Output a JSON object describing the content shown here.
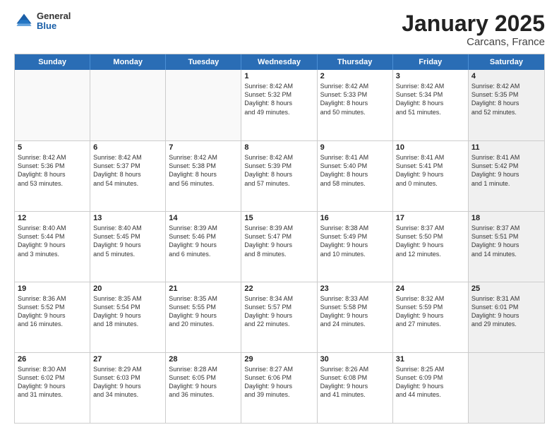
{
  "logo": {
    "general": "General",
    "blue": "Blue"
  },
  "header": {
    "title": "January 2025",
    "location": "Carcans, France"
  },
  "weekdays": [
    "Sunday",
    "Monday",
    "Tuesday",
    "Wednesday",
    "Thursday",
    "Friday",
    "Saturday"
  ],
  "weeks": [
    [
      {
        "day": "",
        "info": "",
        "empty": true
      },
      {
        "day": "",
        "info": "",
        "empty": true
      },
      {
        "day": "",
        "info": "",
        "empty": true
      },
      {
        "day": "1",
        "info": "Sunrise: 8:42 AM\nSunset: 5:32 PM\nDaylight: 8 hours\nand 49 minutes."
      },
      {
        "day": "2",
        "info": "Sunrise: 8:42 AM\nSunset: 5:33 PM\nDaylight: 8 hours\nand 50 minutes."
      },
      {
        "day": "3",
        "info": "Sunrise: 8:42 AM\nSunset: 5:34 PM\nDaylight: 8 hours\nand 51 minutes."
      },
      {
        "day": "4",
        "info": "Sunrise: 8:42 AM\nSunset: 5:35 PM\nDaylight: 8 hours\nand 52 minutes.",
        "shaded": true
      }
    ],
    [
      {
        "day": "5",
        "info": "Sunrise: 8:42 AM\nSunset: 5:36 PM\nDaylight: 8 hours\nand 53 minutes."
      },
      {
        "day": "6",
        "info": "Sunrise: 8:42 AM\nSunset: 5:37 PM\nDaylight: 8 hours\nand 54 minutes."
      },
      {
        "day": "7",
        "info": "Sunrise: 8:42 AM\nSunset: 5:38 PM\nDaylight: 8 hours\nand 56 minutes."
      },
      {
        "day": "8",
        "info": "Sunrise: 8:42 AM\nSunset: 5:39 PM\nDaylight: 8 hours\nand 57 minutes."
      },
      {
        "day": "9",
        "info": "Sunrise: 8:41 AM\nSunset: 5:40 PM\nDaylight: 8 hours\nand 58 minutes."
      },
      {
        "day": "10",
        "info": "Sunrise: 8:41 AM\nSunset: 5:41 PM\nDaylight: 9 hours\nand 0 minutes."
      },
      {
        "day": "11",
        "info": "Sunrise: 8:41 AM\nSunset: 5:42 PM\nDaylight: 9 hours\nand 1 minute.",
        "shaded": true
      }
    ],
    [
      {
        "day": "12",
        "info": "Sunrise: 8:40 AM\nSunset: 5:44 PM\nDaylight: 9 hours\nand 3 minutes."
      },
      {
        "day": "13",
        "info": "Sunrise: 8:40 AM\nSunset: 5:45 PM\nDaylight: 9 hours\nand 5 minutes."
      },
      {
        "day": "14",
        "info": "Sunrise: 8:39 AM\nSunset: 5:46 PM\nDaylight: 9 hours\nand 6 minutes."
      },
      {
        "day": "15",
        "info": "Sunrise: 8:39 AM\nSunset: 5:47 PM\nDaylight: 9 hours\nand 8 minutes."
      },
      {
        "day": "16",
        "info": "Sunrise: 8:38 AM\nSunset: 5:49 PM\nDaylight: 9 hours\nand 10 minutes."
      },
      {
        "day": "17",
        "info": "Sunrise: 8:37 AM\nSunset: 5:50 PM\nDaylight: 9 hours\nand 12 minutes."
      },
      {
        "day": "18",
        "info": "Sunrise: 8:37 AM\nSunset: 5:51 PM\nDaylight: 9 hours\nand 14 minutes.",
        "shaded": true
      }
    ],
    [
      {
        "day": "19",
        "info": "Sunrise: 8:36 AM\nSunset: 5:52 PM\nDaylight: 9 hours\nand 16 minutes."
      },
      {
        "day": "20",
        "info": "Sunrise: 8:35 AM\nSunset: 5:54 PM\nDaylight: 9 hours\nand 18 minutes."
      },
      {
        "day": "21",
        "info": "Sunrise: 8:35 AM\nSunset: 5:55 PM\nDaylight: 9 hours\nand 20 minutes."
      },
      {
        "day": "22",
        "info": "Sunrise: 8:34 AM\nSunset: 5:57 PM\nDaylight: 9 hours\nand 22 minutes."
      },
      {
        "day": "23",
        "info": "Sunrise: 8:33 AM\nSunset: 5:58 PM\nDaylight: 9 hours\nand 24 minutes."
      },
      {
        "day": "24",
        "info": "Sunrise: 8:32 AM\nSunset: 5:59 PM\nDaylight: 9 hours\nand 27 minutes."
      },
      {
        "day": "25",
        "info": "Sunrise: 8:31 AM\nSunset: 6:01 PM\nDaylight: 9 hours\nand 29 minutes.",
        "shaded": true
      }
    ],
    [
      {
        "day": "26",
        "info": "Sunrise: 8:30 AM\nSunset: 6:02 PM\nDaylight: 9 hours\nand 31 minutes."
      },
      {
        "day": "27",
        "info": "Sunrise: 8:29 AM\nSunset: 6:03 PM\nDaylight: 9 hours\nand 34 minutes."
      },
      {
        "day": "28",
        "info": "Sunrise: 8:28 AM\nSunset: 6:05 PM\nDaylight: 9 hours\nand 36 minutes."
      },
      {
        "day": "29",
        "info": "Sunrise: 8:27 AM\nSunset: 6:06 PM\nDaylight: 9 hours\nand 39 minutes."
      },
      {
        "day": "30",
        "info": "Sunrise: 8:26 AM\nSunset: 6:08 PM\nDaylight: 9 hours\nand 41 minutes."
      },
      {
        "day": "31",
        "info": "Sunrise: 8:25 AM\nSunset: 6:09 PM\nDaylight: 9 hours\nand 44 minutes."
      },
      {
        "day": "",
        "info": "",
        "empty": true,
        "shaded": true
      }
    ]
  ]
}
